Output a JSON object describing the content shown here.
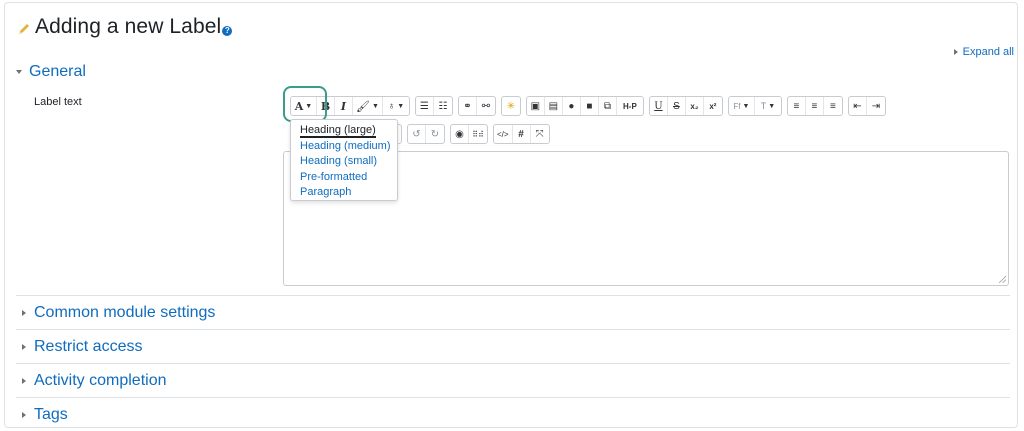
{
  "page": {
    "title": "Adding a new Label",
    "help_glyph": "?",
    "expand_all": "Expand all"
  },
  "general": {
    "header": "General",
    "label_text": "Label text"
  },
  "toolbar": {
    "paragraph_styles": "A",
    "bold": "B",
    "italic": "I",
    "h5p": "H-P",
    "underline": "U",
    "strike": "S",
    "subscript": "x₂",
    "superscript": "x²",
    "font_family": "Ff",
    "font_size": "T",
    "html_glyph": "</>",
    "hash_glyph": "#"
  },
  "heading_menu": {
    "items": [
      "Heading (large)",
      "Heading (medium)",
      "Heading (small)",
      "Pre-formatted",
      "Paragraph"
    ]
  },
  "sections": [
    "Common module settings",
    "Restrict access",
    "Activity completion",
    "Tags"
  ],
  "colors": {
    "link": "#0f6cbf",
    "highlight": "#3c9b8b",
    "pencil": "#e0b43a"
  }
}
